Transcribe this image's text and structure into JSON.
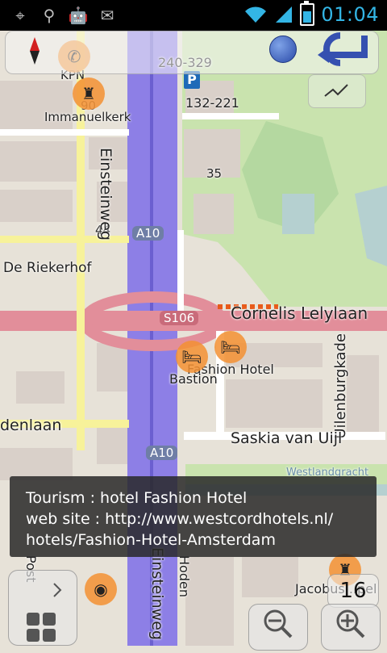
{
  "status_bar": {
    "time": "01:04",
    "icons": [
      "gps-icon",
      "usb-icon",
      "android-debug-icon",
      "gmail-icon",
      "wifi-icon",
      "signal-icon",
      "battery-icon"
    ]
  },
  "map": {
    "labels": {
      "kpn": "KPN",
      "immanuelkerk": "Immanuelkerk",
      "house_240": "240-329",
      "house_132": "132-221",
      "num_35": "35",
      "num_44": "44",
      "num_90": "90",
      "einsteinweg_top": "Einsteinweg",
      "einsteinweg_bottom": "Einsteinweg",
      "a10_top": "A10",
      "a10_bottom": "A10",
      "s106": "S106",
      "de_riekerhof": "De Riekerhof",
      "cornelis_lelylaan": "Cornelis Lelylaan",
      "fashion_hotel": "Fashion Hotel",
      "bastion": "Bastion",
      "uilenburgkade": "Uilenburgkade",
      "saskia": "Saskia van Uijl",
      "denlaan": "denlaan",
      "westlandgracht": "Westlandgracht",
      "hoden": "Hoden",
      "jacobus": "Jacobus...pel",
      "post": "Post"
    }
  },
  "info_popup": {
    "line1": "Tourism : hotel Fashion Hotel",
    "line2": "web site : http://www.westcordhotels.nl/",
    "line3": "hotels/Fashion-Hotel-Amsterdam"
  },
  "controls": {
    "zoom_level": "16"
  }
}
